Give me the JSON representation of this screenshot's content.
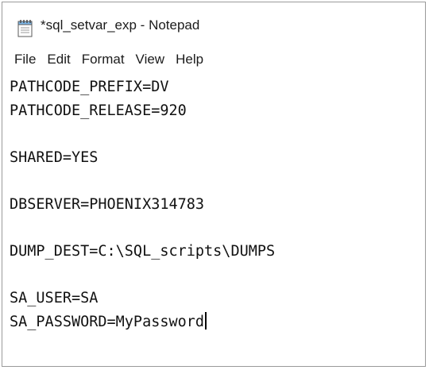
{
  "window": {
    "title": "*sql_setvar_exp - Notepad",
    "icon": "notepad-icon"
  },
  "menu": {
    "items": [
      "File",
      "Edit",
      "Format",
      "View",
      "Help"
    ]
  },
  "editor": {
    "lines": [
      "PATHCODE_PREFIX=DV",
      "PATHCODE_RELEASE=920",
      "",
      "SHARED=YES",
      "",
      "DBSERVER=PHOENIX314783",
      "",
      "DUMP_DEST=C:\\SQL_scripts\\DUMPS",
      "",
      "SA_USER=SA",
      "SA_PASSWORD=MyPassword"
    ]
  }
}
